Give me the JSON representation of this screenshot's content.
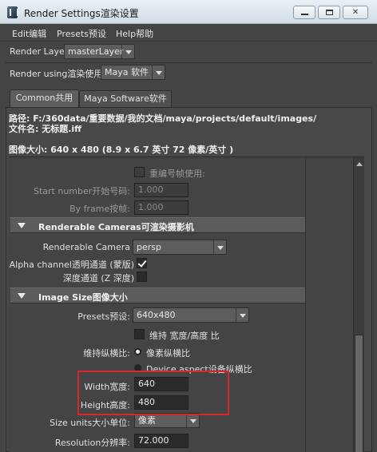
{
  "window": {
    "title": "Render Settings渲染设置",
    "min_symbol": "",
    "max_symbol": "",
    "close_symbol": "✕"
  },
  "menu": [
    "Edit编辑",
    "Presets预设",
    "Help帮助"
  ],
  "render_layer": {
    "label": "Render Layer",
    "value": "masterLayer"
  },
  "render_using": {
    "label": "Render using渲染使用:",
    "value": "Maya 软件"
  },
  "tabs": [
    {
      "label": "Common共用",
      "active": true
    },
    {
      "label": "Maya Software软件",
      "active": false
    }
  ],
  "info": {
    "path": "路径: F:/360data/重要数据/我的文档/maya/projects/default/images/",
    "filename": "文件名: 无标题.iff",
    "image_size": "图像大小: 640 x 480 (8.9 x 6.7 英寸 72 像素/英寸 )"
  },
  "frame_padding": {
    "label": "重编号帧使用:",
    "checked": false
  },
  "start_number": {
    "label": "Start number开始号码:",
    "value": "1.000"
  },
  "by_frame": {
    "label": "By frame按帧:",
    "value": "1.000"
  },
  "cameras_section": {
    "title": "Renderable Cameras可渲染摄影机"
  },
  "renderable_camera": {
    "label": "Renderable Camera",
    "value": "persp"
  },
  "alpha_channel": {
    "label": "Alpha channel透明通道 (蒙版)",
    "checked": true
  },
  "depth_channel": {
    "label": "深度通道 (Z 深度)",
    "checked": false
  },
  "image_size_section": {
    "title": "Image Size图像大小"
  },
  "presets": {
    "label": "Presets预设:",
    "value": "640x480"
  },
  "maintain_ratio": {
    "label": "维持 宽度/高度 比",
    "checked": false
  },
  "maintain_ratio_by": {
    "label": "维持纵横比:"
  },
  "pixel_aspect": {
    "label": "像素纵横比",
    "selected": true
  },
  "device_aspect": {
    "label": "Device aspect设备纵横比",
    "selected": false
  },
  "width": {
    "label": "Width宽度:",
    "value": "640"
  },
  "height": {
    "label": "Height高度:",
    "value": "480"
  },
  "size_units": {
    "label": "Size units大小单位:",
    "value": "像素"
  },
  "resolution": {
    "label": "Resolution分辨率:",
    "value": "72.000"
  },
  "colors": {
    "highlight": "#d9262b",
    "panel": "#444444"
  }
}
